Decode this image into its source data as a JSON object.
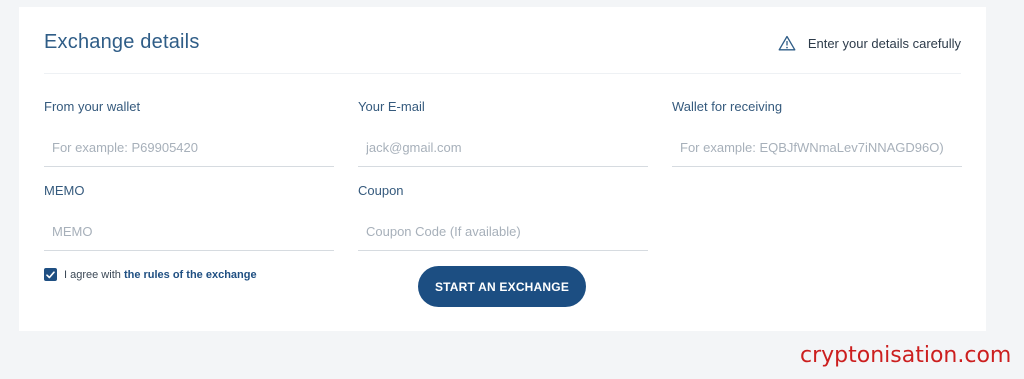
{
  "form": {
    "title": "Exchange details",
    "notice": "Enter your details carefully",
    "notice_icon": "warning-icon",
    "fields": {
      "from_wallet": {
        "label": "From your wallet",
        "placeholder": "For example: P69905420",
        "value": ""
      },
      "email": {
        "label": "Your E-mail",
        "placeholder": "jack@gmail.com",
        "value": ""
      },
      "receiving_wallet": {
        "label": "Wallet for receiving",
        "placeholder": "For example: EQBJfWNmaLev7iNNAGD96O)",
        "value": ""
      },
      "memo": {
        "label": "MEMO",
        "placeholder": "MEMO",
        "value": ""
      },
      "coupon": {
        "label": "Coupon",
        "placeholder": "Coupon Code (If available)",
        "value": ""
      }
    },
    "agree": {
      "checked": true,
      "text": "I agree with",
      "link_text": "the rules of the exchange"
    },
    "submit_label": "START AN EXCHANGE"
  },
  "watermark": "cryptonisation.com",
  "colors": {
    "accent": "#1c4e82",
    "title": "#2f5d87",
    "background": "#f3f5f7",
    "watermark": "#cc1f1f"
  }
}
